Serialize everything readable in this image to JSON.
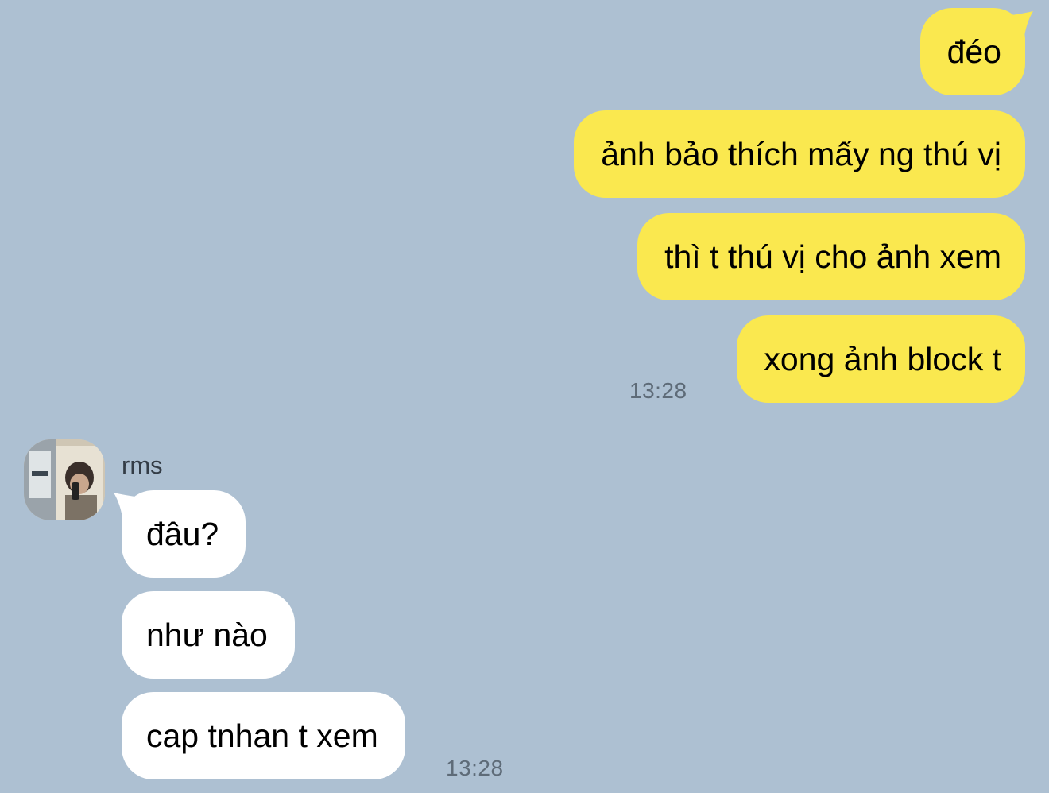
{
  "colors": {
    "background": "#adc0d2",
    "outgoing_bubble": "#fae84f",
    "incoming_bubble": "#ffffff",
    "timestamp_text": "#5e6b78"
  },
  "outgoing": {
    "messages": [
      "đéo",
      "ảnh bảo thích mấy ng thú vị",
      "thì t thú vị cho ảnh xem",
      "xong ảnh block t"
    ],
    "timestamp": "13:28"
  },
  "incoming": {
    "sender_name": "rms",
    "avatar_icon": "user-photo-avatar",
    "messages": [
      "đâu?",
      "như nào",
      "cap tnhan t xem"
    ],
    "timestamp": "13:28"
  }
}
